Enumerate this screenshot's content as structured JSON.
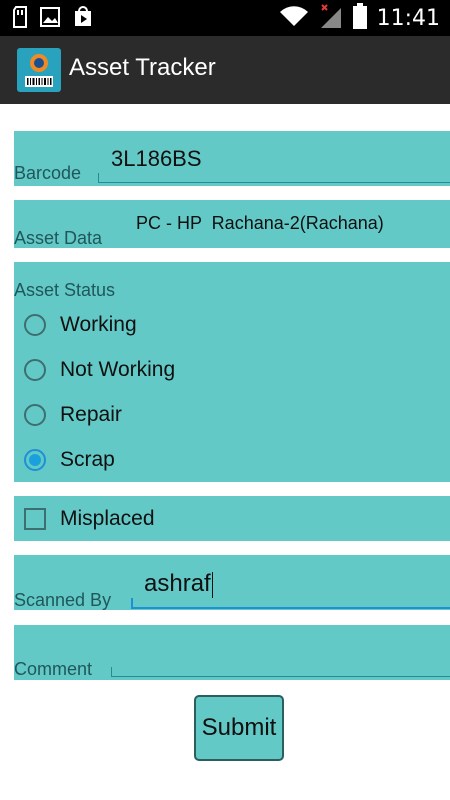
{
  "status_bar": {
    "time": "11:41",
    "icons_left": [
      "sd-card-icon",
      "image-icon",
      "play-store-icon"
    ],
    "icons_right": [
      "wifi-icon",
      "signal-no-service-icon",
      "battery-icon"
    ]
  },
  "app_bar": {
    "title": "Asset Tracker",
    "icon": "barcode-app-icon"
  },
  "form": {
    "barcode": {
      "label": "Barcode",
      "value": "3L186BS"
    },
    "asset_data": {
      "label": "Asset Data",
      "value": "PC - HP  Rachana-2(Rachana)"
    },
    "asset_status": {
      "label": "Asset Status",
      "options": [
        "Working",
        "Not Working",
        "Repair",
        "Scrap"
      ],
      "selected": "Scrap"
    },
    "misplaced": {
      "label": "Misplaced",
      "checked": false
    },
    "scanned_by": {
      "label": "Scanned By",
      "value": "ashraf"
    },
    "comment": {
      "label": "Comment",
      "value": ""
    },
    "submit_label": "Submit"
  },
  "colors": {
    "panel": "#62c9c6",
    "action_bar": "#2b2b2b",
    "accent": "#1aa0dc"
  }
}
